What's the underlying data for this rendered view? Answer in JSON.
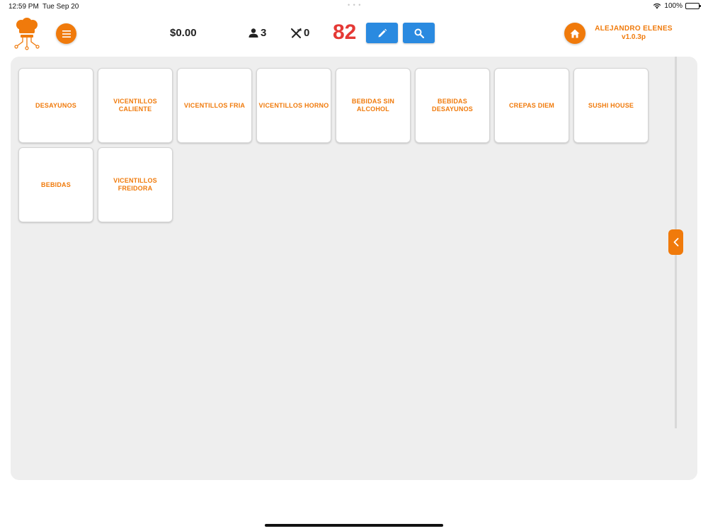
{
  "status_bar": {
    "time": "12:59 PM",
    "date": "Tue Sep 20",
    "battery": "100%"
  },
  "header": {
    "amount": "$0.00",
    "guests_count": "3",
    "orders_count": "0",
    "table_number": "82",
    "user_name": "ALEJANDRO ELENES",
    "app_version": "v1.0.3p"
  },
  "categories": [
    "DESAYUNOS",
    "VICENTILLOS CALIENTE",
    "VICENTILLOS FRIA",
    "VICENTILLOS HORNO",
    "BEBIDAS SIN ALCOHOL",
    "BEBIDAS DESAYUNOS",
    "CREPAS DIEM",
    "SUSHI HOUSE",
    "BEBIDAS",
    "VICENTILLOS FREIDORA"
  ],
  "colors": {
    "accent": "#f07a0b",
    "primary_button": "#2a8ae0",
    "table_number": "#e53935",
    "panel_background": "#eeeeee"
  },
  "icons": {
    "logo": "chef-hat-circuit-logo",
    "menu": "hamburger-icon",
    "guests": "person-icon",
    "orders": "utensils-icon",
    "edit": "pencil-icon",
    "search": "search-icon",
    "home": "home-icon",
    "collapse": "chevron-left-icon"
  }
}
